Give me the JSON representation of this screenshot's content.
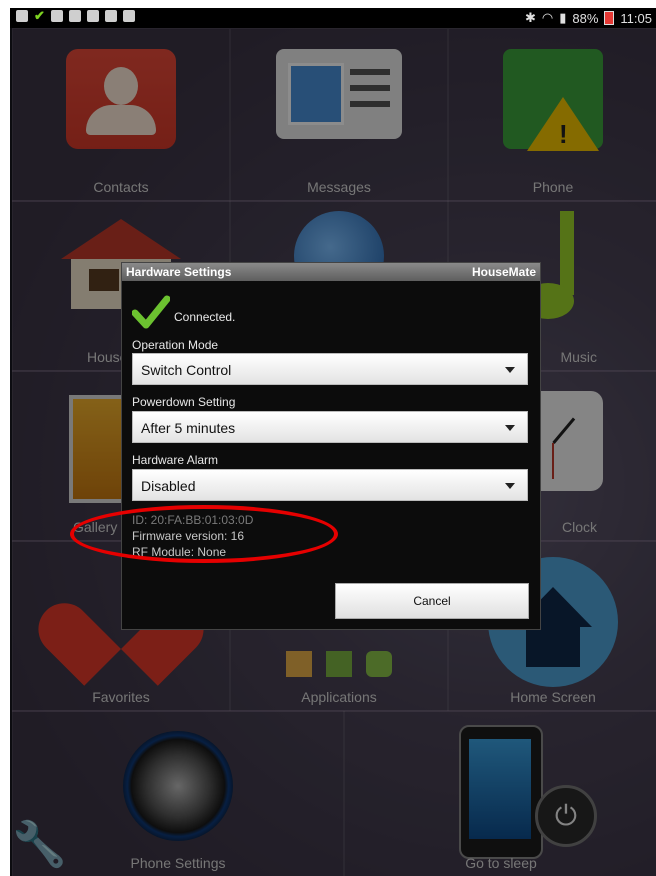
{
  "statusbar": {
    "battery": "88%",
    "time": "11:05"
  },
  "tiles": [
    {
      "label": "Contacts"
    },
    {
      "label": "Messages"
    },
    {
      "label": "Phone"
    },
    {
      "label": "HouseM"
    },
    {
      "label": "Music"
    },
    {
      "label": "Gallery"
    },
    {
      "label": "Clock"
    },
    {
      "label": "Favorites"
    },
    {
      "label": "Applications"
    },
    {
      "label": "Home Screen"
    },
    {
      "label": "Phone Settings"
    },
    {
      "label": "Go to sleep"
    }
  ],
  "dialog": {
    "title": "Hardware Settings",
    "brand": "HouseMate",
    "status": "Connected.",
    "operation_mode_label": "Operation Mode",
    "operation_mode_value": "Switch Control",
    "powerdown_label": "Powerdown Setting",
    "powerdown_value": "After 5 minutes",
    "alarm_label": "Hardware Alarm",
    "alarm_value": "Disabled",
    "device_id": "ID: 20:FA:BB:01:03:0D",
    "firmware": "Firmware version: 16",
    "rf_module": "RF Module: None",
    "cancel_label": "Cancel"
  }
}
